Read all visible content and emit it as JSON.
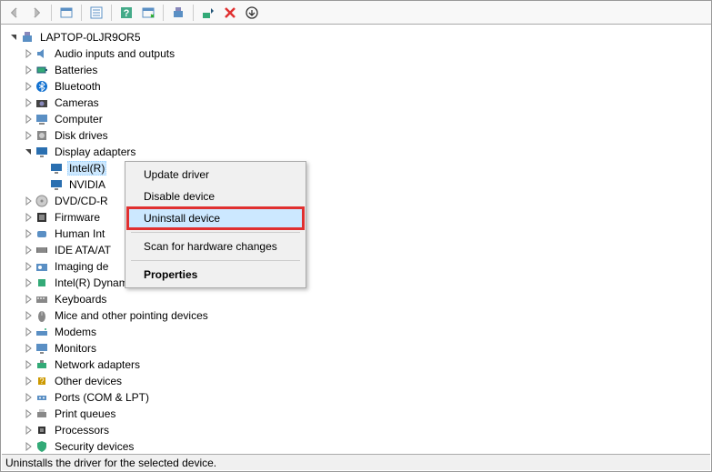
{
  "toolbar": {
    "back": "back",
    "forward": "forward"
  },
  "root": {
    "label": "LAPTOP-0LJR9OR5"
  },
  "categories": [
    {
      "label": "Audio inputs and outputs",
      "icon": "audio"
    },
    {
      "label": "Batteries",
      "icon": "battery"
    },
    {
      "label": "Bluetooth",
      "icon": "bluetooth"
    },
    {
      "label": "Cameras",
      "icon": "camera"
    },
    {
      "label": "Computer",
      "icon": "computer"
    },
    {
      "label": "Disk drives",
      "icon": "disk"
    },
    {
      "label": "Display adapters",
      "icon": "display",
      "expanded": true,
      "children": [
        {
          "label": "Intel(R)",
          "icon": "display",
          "selected": true
        },
        {
          "label": "NVIDIA",
          "icon": "display"
        }
      ]
    },
    {
      "label": "DVD/CD-R",
      "icon": "dvd"
    },
    {
      "label": "Firmware",
      "icon": "firmware"
    },
    {
      "label": "Human Int",
      "icon": "hid"
    },
    {
      "label": "IDE ATA/AT",
      "icon": "ide"
    },
    {
      "label": "Imaging de",
      "icon": "imaging"
    },
    {
      "label": "Intel(R) Dynamic Platform and Thermal Framework",
      "icon": "thermal"
    },
    {
      "label": "Keyboards",
      "icon": "keyboard"
    },
    {
      "label": "Mice and other pointing devices",
      "icon": "mouse"
    },
    {
      "label": "Modems",
      "icon": "modem"
    },
    {
      "label": "Monitors",
      "icon": "monitor"
    },
    {
      "label": "Network adapters",
      "icon": "network"
    },
    {
      "label": "Other devices",
      "icon": "other"
    },
    {
      "label": "Ports (COM & LPT)",
      "icon": "port"
    },
    {
      "label": "Print queues",
      "icon": "printer"
    },
    {
      "label": "Processors",
      "icon": "cpu"
    },
    {
      "label": "Security devices",
      "icon": "security"
    }
  ],
  "context_menu": {
    "items": [
      {
        "label": "Update driver",
        "type": "item"
      },
      {
        "label": "Disable device",
        "type": "item"
      },
      {
        "label": "Uninstall device",
        "type": "item",
        "highlighted": true
      },
      {
        "type": "sep"
      },
      {
        "label": "Scan for hardware changes",
        "type": "item"
      },
      {
        "type": "sep"
      },
      {
        "label": "Properties",
        "type": "item",
        "bold": true
      }
    ]
  },
  "status_bar": {
    "text": "Uninstalls the driver for the selected device."
  }
}
